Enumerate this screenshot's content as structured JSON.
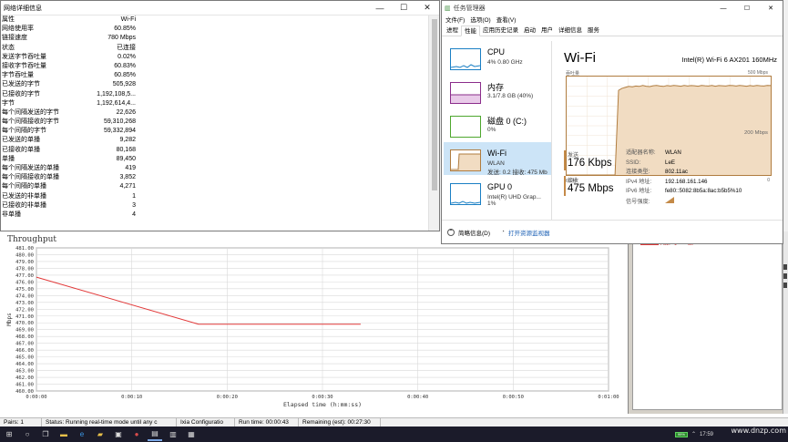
{
  "net_window": {
    "title": "网络详细信息",
    "header_key": "属性",
    "header_value": "Wi-Fi",
    "rows": [
      {
        "k": "网络使用率",
        "v": "60.85%"
      },
      {
        "k": "链接速度",
        "v": "780 Mbps"
      },
      {
        "k": "状态",
        "v": "已连接"
      },
      {
        "k": "发送字节吞吐量",
        "v": "0.02%"
      },
      {
        "k": "接收字节吞吐量",
        "v": "60.83%"
      },
      {
        "k": "字节吞吐量",
        "v": "60.85%"
      },
      {
        "k": "已发送的字节",
        "v": "505,928"
      },
      {
        "k": "已接收的字节",
        "v": "1,192,108,5..."
      },
      {
        "k": "字节",
        "v": "1,192,614,4..."
      },
      {
        "k": "每个间隔发送的字节",
        "v": "22,626"
      },
      {
        "k": "每个间隔接收的字节",
        "v": "59,310,268"
      },
      {
        "k": "每个间隔的字节",
        "v": "59,332,894"
      },
      {
        "k": "已发送的单播",
        "v": "9,282"
      },
      {
        "k": "已接收的单播",
        "v": "80,168"
      },
      {
        "k": "单播",
        "v": "89,450"
      },
      {
        "k": "每个间隔发送的单播",
        "v": "419"
      },
      {
        "k": "每个间隔接收的单播",
        "v": "3,852"
      },
      {
        "k": "每个间隔的单播",
        "v": "4,271"
      },
      {
        "k": "已发送的非单播",
        "v": "1"
      },
      {
        "k": "已接收的非单播",
        "v": "3"
      },
      {
        "k": "非单播",
        "v": "4"
      }
    ]
  },
  "task_manager": {
    "title": "任务管理器",
    "menu": [
      "文件(F)",
      "选项(O)",
      "查看(V)"
    ],
    "tabs": [
      "进程",
      "性能",
      "应用历史记录",
      "启动",
      "用户",
      "详细信息",
      "服务"
    ],
    "selected_tab": 1,
    "resources": [
      {
        "name": "CPU",
        "sub": "4% 0.80 GHz",
        "color": "#1a7fc4"
      },
      {
        "name": "内存",
        "sub": "3.1/7.8 GB (40%)",
        "color": "#8b2d8b"
      },
      {
        "name": "磁盘 0 (C:)",
        "sub": "0%",
        "color": "#4ea72e"
      },
      {
        "name": "Wi-Fi",
        "sub": "WLAN",
        "sub2": "发送: 0.2 接收: 475 Mb",
        "color": "#b07c3f"
      },
      {
        "name": "GPU 0",
        "sub": "Intel(R) UHD Grap...",
        "sub2": "1%",
        "color": "#1a7fc4"
      }
    ],
    "heading": "Wi-Fi",
    "adapter": "Intel(R) Wi-Fi 6 AX201 160MHz",
    "graph_caption": "吞吐量",
    "graph_max": "500 Mbps",
    "graph_mid": "200 Mbps",
    "graph_left": "60 秒",
    "graph_right": "0",
    "throughput_series": [
      0,
      0,
      0,
      0,
      0,
      0,
      0,
      0,
      0,
      0,
      0,
      0,
      0,
      0,
      0,
      430,
      440,
      445,
      450,
      448,
      452,
      450,
      455,
      451,
      449,
      453,
      455,
      452,
      450,
      454,
      452,
      455,
      453,
      451,
      455,
      452,
      454,
      453,
      451,
      455,
      453,
      452,
      455,
      451,
      454,
      453,
      452,
      455,
      454,
      452,
      455,
      453,
      451,
      454,
      452,
      455,
      453,
      452,
      455,
      454
    ],
    "send_label": "发送",
    "send_value": "176 Kbps",
    "recv_label": "接收",
    "recv_value": "475 Mbps",
    "details": [
      {
        "k": "适配器名称:",
        "v": "WLAN"
      },
      {
        "k": "SSID:",
        "v": "LeE"
      },
      {
        "k": "连接类型:",
        "v": "802.11ac"
      },
      {
        "k": "IPv4 地址:",
        "v": "192.168.161.146"
      },
      {
        "k": "IPv6 地址:",
        "v": "fe80::5082:8b5a:8ac:b5b5%10"
      },
      {
        "k": "信号强度:",
        "v": ""
      }
    ],
    "footer_less": "简略信息(D)",
    "footer_link": "打开资源监视器"
  },
  "ixia": {
    "chart_title": "Throughput",
    "legend_text": "Pair 1 -- ae",
    "status": [
      "Pairs: 1",
      "Status: Running real-time mode until any c",
      "Ixia Configuratio",
      "Run time: 00:00:43",
      "Remaining (est): 00:27:30"
    ]
  },
  "chart_data": {
    "type": "line",
    "title": "Throughput",
    "xlabel": "Elapsed time (h:mm:ss)",
    "ylabel": "Mbps",
    "x_ticks": [
      "0:00:00",
      "0:00:10",
      "0:00:20",
      "0:00:30",
      "0:00:40",
      "0:00:50",
      "0:01:00"
    ],
    "y_ticks": [
      "460.00",
      "461.00",
      "462.00",
      "463.00",
      "464.00",
      "465.00",
      "466.00",
      "467.00",
      "468.00",
      "469.00",
      "470.00",
      "471.00",
      "472.00",
      "473.00",
      "474.00",
      "475.00",
      "476.00",
      "477.00",
      "478.00",
      "479.00",
      "480.00",
      "481.00"
    ],
    "xlim": [
      0,
      60
    ],
    "ylim": [
      460,
      481
    ],
    "grid": true,
    "series": [
      {
        "name": "Pair 1",
        "color": "#e23a3a",
        "x": [
          0,
          17,
          17,
          34
        ],
        "y": [
          476.7,
          469.8,
          469.8,
          469.8
        ]
      }
    ]
  },
  "taskbar": {
    "battery": "99%",
    "time": "17:59",
    "watermark": "www.dnzp.com"
  }
}
